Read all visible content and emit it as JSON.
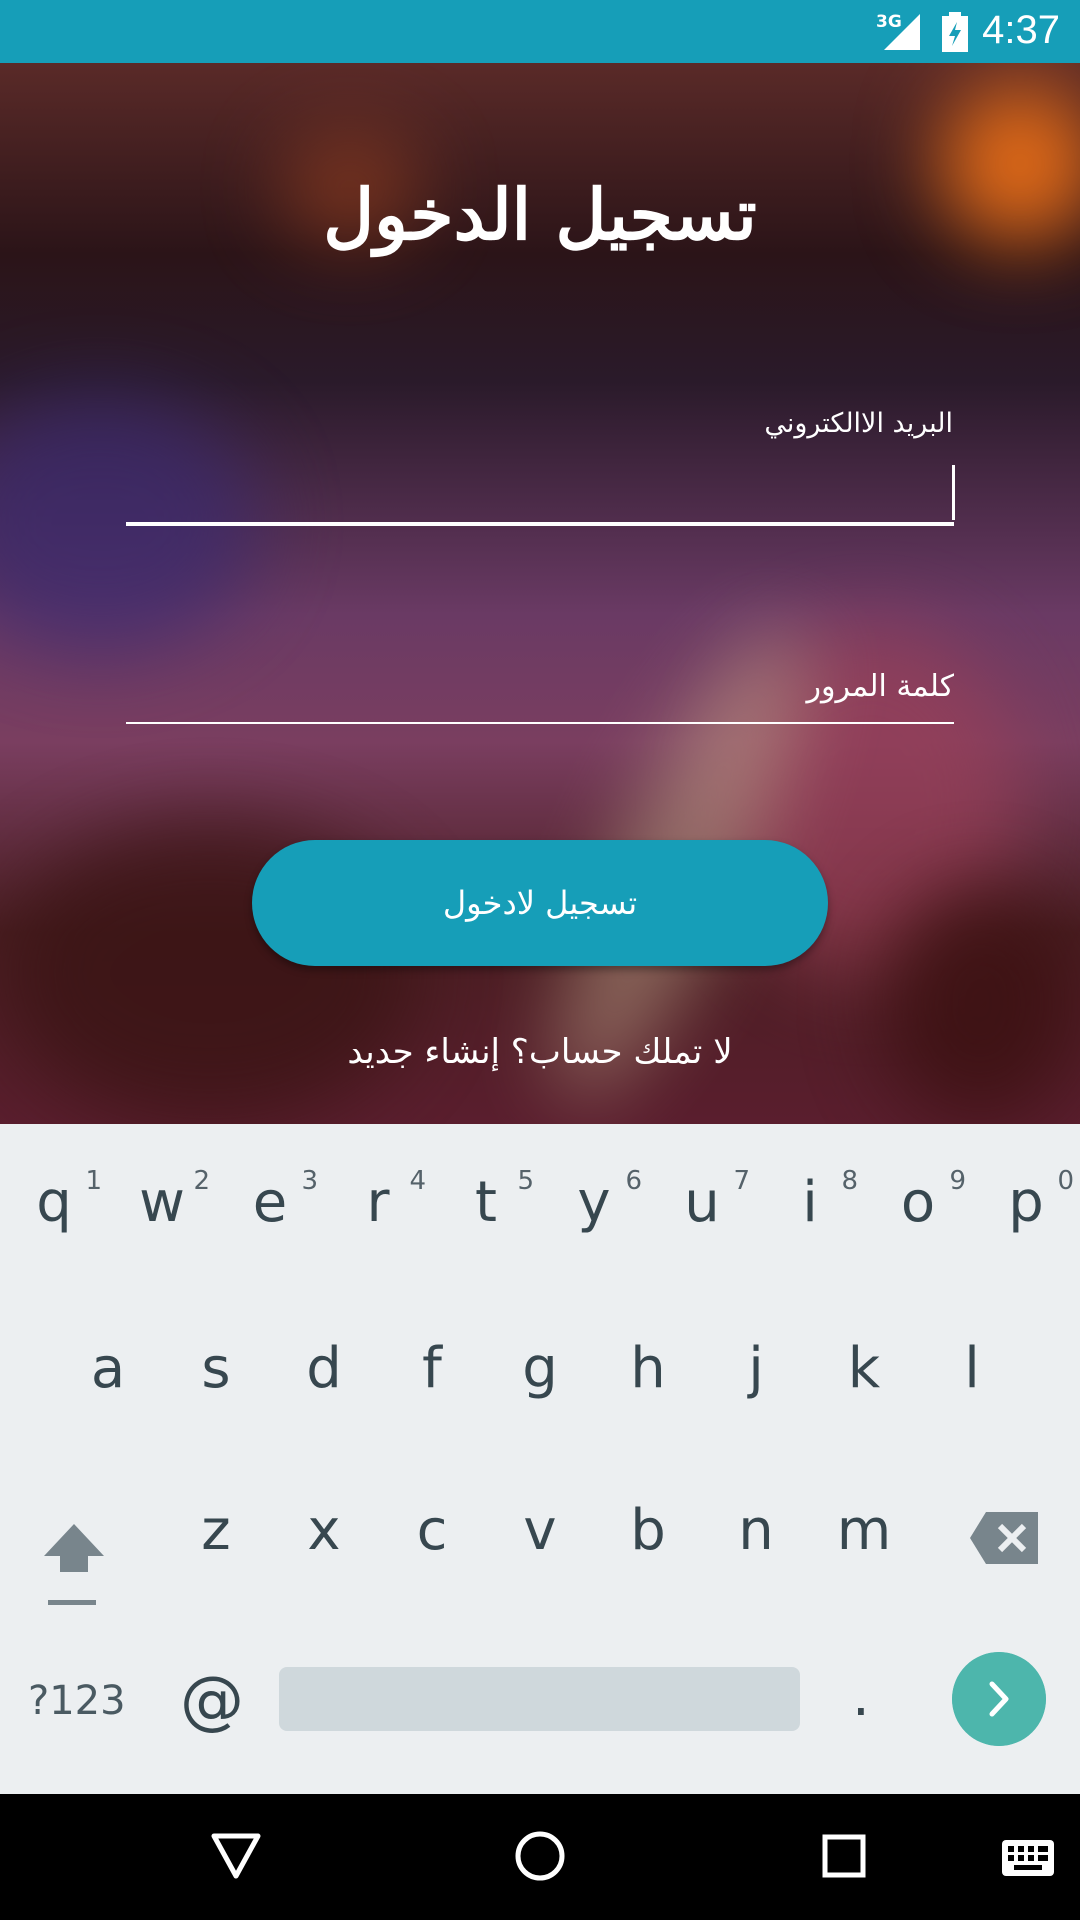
{
  "status_bar": {
    "network": "3G",
    "time": "4:37"
  },
  "login": {
    "title": "تسجيل الدخول",
    "email_label": "البريد الاالكتروني",
    "password_placeholder": "كلمة المرور",
    "login_button": "تسجيل لادخول",
    "signup_link": "لا تملك حساب؟ إنشاء جديد"
  },
  "keyboard": {
    "row1": [
      {
        "key": "q",
        "hint": "1"
      },
      {
        "key": "w",
        "hint": "2"
      },
      {
        "key": "e",
        "hint": "3"
      },
      {
        "key": "r",
        "hint": "4"
      },
      {
        "key": "t",
        "hint": "5"
      },
      {
        "key": "y",
        "hint": "6"
      },
      {
        "key": "u",
        "hint": "7"
      },
      {
        "key": "i",
        "hint": "8"
      },
      {
        "key": "o",
        "hint": "9"
      },
      {
        "key": "p",
        "hint": "0"
      }
    ],
    "row2": [
      "a",
      "s",
      "d",
      "f",
      "g",
      "h",
      "j",
      "k",
      "l"
    ],
    "row3": [
      "z",
      "x",
      "c",
      "v",
      "b",
      "n",
      "m"
    ],
    "symbols_key": "?123",
    "at_key": "@",
    "period_key": "."
  },
  "colors": {
    "accent": "#169eb8",
    "keyboard_bg": "#eceff1",
    "go_key": "#4db6ac"
  }
}
